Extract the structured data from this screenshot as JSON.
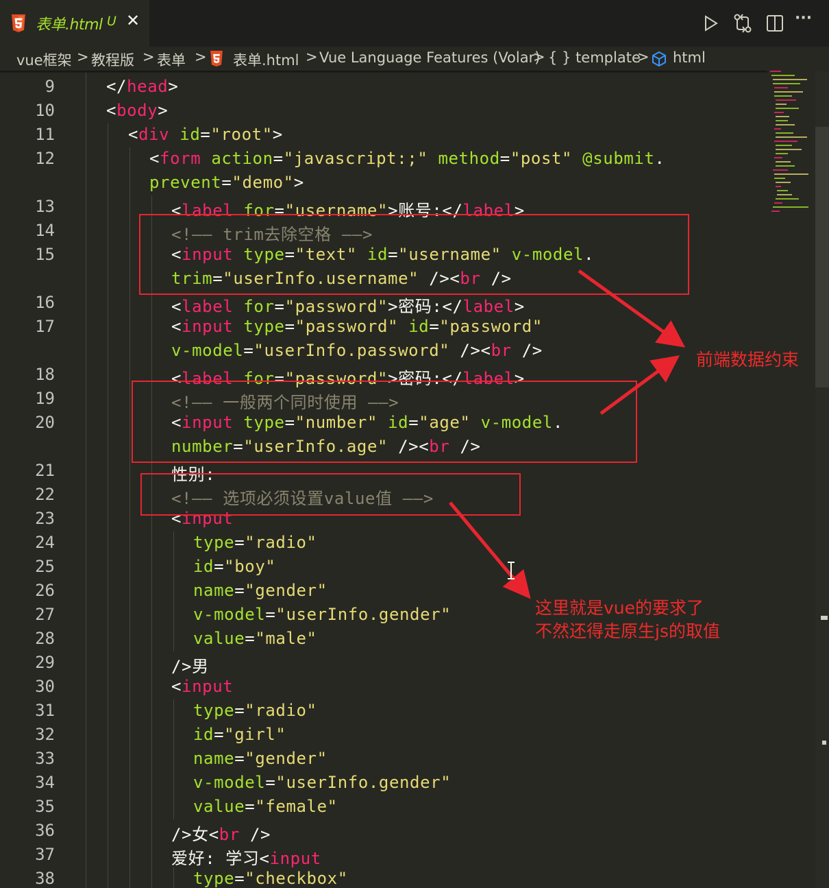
{
  "tab": {
    "filename": "表单.html",
    "status": "U",
    "close_glyph": "✕"
  },
  "toolbar": {
    "run_icon": "play-icon",
    "compare_icon": "git-compare-icon",
    "split_icon": "split-editor-icon",
    "more_label": "···"
  },
  "breadcrumb": {
    "items": [
      "vue框架",
      "教程版",
      "表单",
      "表单.html",
      "Vue Language Features (Volar)",
      "{ } template",
      "html"
    ],
    "separator": ">"
  },
  "line_numbers": [
    "9",
    "10",
    "11",
    "12",
    "",
    "13",
    "14",
    "15",
    "",
    "16",
    "17",
    "",
    "18",
    "19",
    "20",
    "",
    "21",
    "22",
    "23",
    "24",
    "25",
    "26",
    "27",
    "28",
    "29",
    "30",
    "31",
    "32",
    "33",
    "34",
    "35",
    "36",
    "37",
    "38"
  ],
  "annotations": {
    "note1": "前端数据约束",
    "note2_line1": "这里就是vue的要求了",
    "note2_line2": "不然还得走原生js的取值"
  },
  "colors": {
    "background": "#272822",
    "tag_name": "#f92672",
    "attribute": "#a6e22e",
    "string": "#e6db74",
    "comment": "#88846f",
    "annotation_red": "#e8252f"
  }
}
